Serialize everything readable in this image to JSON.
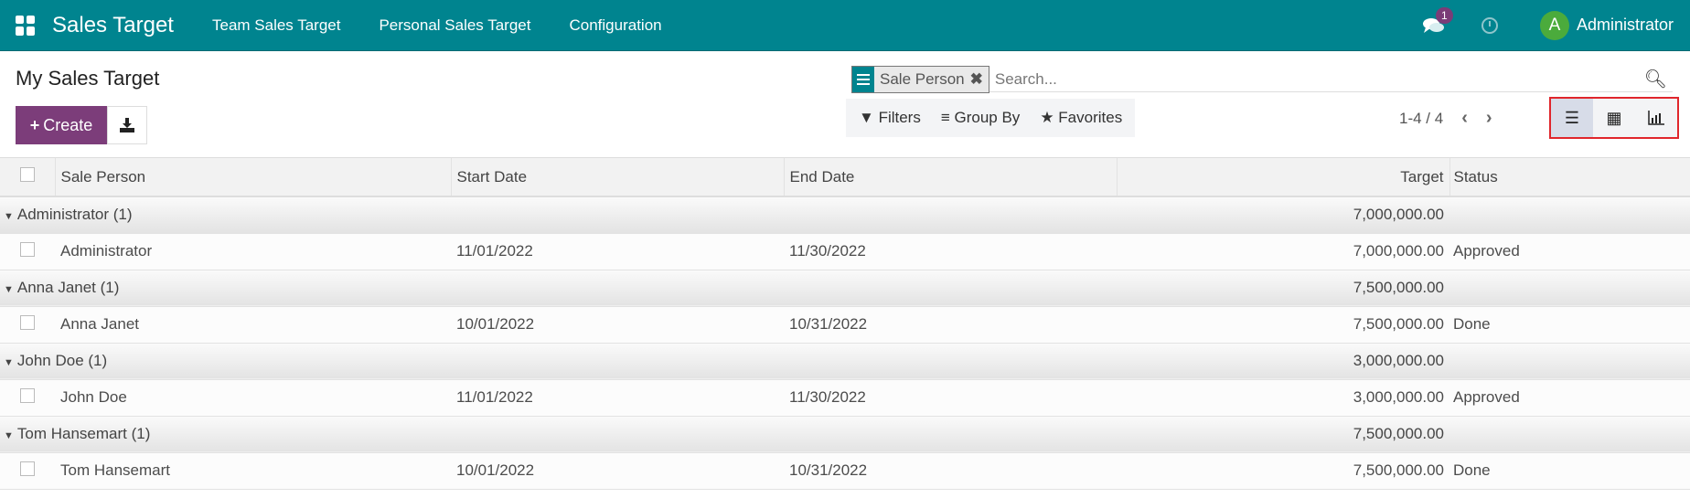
{
  "navbar": {
    "app_title": "Sales Target",
    "menu": [
      "Team Sales Target",
      "Personal Sales Target",
      "Configuration"
    ],
    "message_count": "1",
    "user_initial": "A",
    "user_name": "Administrator",
    "accent": "#00848f"
  },
  "control": {
    "title": "My Sales Target",
    "create_label": "Create",
    "facet_label": "Sale Person",
    "search_placeholder": "Search...",
    "filters_label": "Filters",
    "groupby_label": "Group By",
    "favorites_label": "Favorites",
    "pager": "1-4 / 4",
    "views": [
      "list-view",
      "pivot-view",
      "graph-view"
    ],
    "active_view": "list-view"
  },
  "table": {
    "headers": [
      "Sale Person",
      "Start Date",
      "End Date",
      "Target",
      "Status"
    ],
    "groups": [
      {
        "label": "Administrator (1)",
        "total": "7,000,000.00",
        "rows": [
          {
            "person": "Administrator",
            "start": "11/01/2022",
            "end": "11/30/2022",
            "target": "7,000,000.00",
            "status": "Approved"
          }
        ]
      },
      {
        "label": "Anna Janet (1)",
        "total": "7,500,000.00",
        "rows": [
          {
            "person": "Anna Janet",
            "start": "10/01/2022",
            "end": "10/31/2022",
            "target": "7,500,000.00",
            "status": "Done"
          }
        ]
      },
      {
        "label": "John Doe (1)",
        "total": "3,000,000.00",
        "rows": [
          {
            "person": "John Doe",
            "start": "11/01/2022",
            "end": "11/30/2022",
            "target": "3,000,000.00",
            "status": "Approved"
          }
        ]
      },
      {
        "label": "Tom Hansemart (1)",
        "total": "7,500,000.00",
        "rows": [
          {
            "person": "Tom Hansemart",
            "start": "10/01/2022",
            "end": "10/31/2022",
            "target": "7,500,000.00",
            "status": "Done"
          }
        ]
      }
    ]
  }
}
